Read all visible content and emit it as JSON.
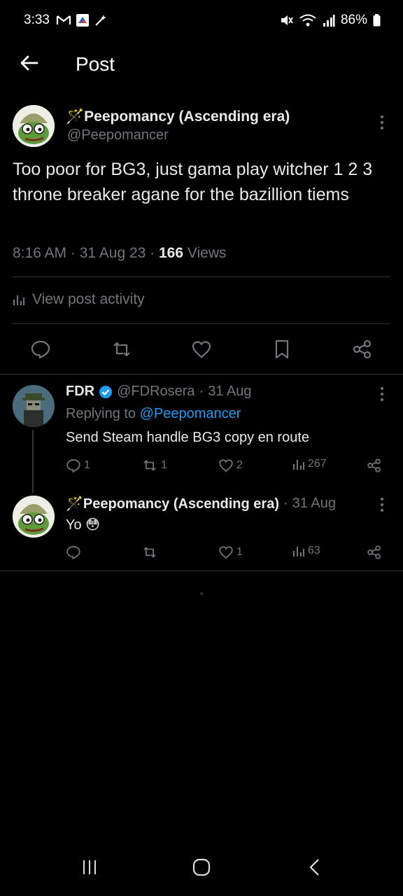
{
  "status_bar": {
    "time": "3:33",
    "battery": "86%"
  },
  "header": {
    "title": "Post"
  },
  "post": {
    "author_name": "🪄Peepomancy (Ascending era)",
    "author_handle": "@Peepomancer",
    "text": "Too poor for BG3, just gama play witcher 1 2 3 throne breaker agane for the bazillion tiems",
    "time": "8:16 AM",
    "date": "31 Aug 23",
    "views_count": "166",
    "views_label": "Views",
    "activity_label": "View post activity"
  },
  "replies": [
    {
      "name": "FDR",
      "handle": "@FDRosera",
      "date": "31 Aug",
      "replying_label": "Replying to",
      "replying_to": "@Peepomancer",
      "text": "Send Steam handle BG3 copy en route",
      "replies": "1",
      "reposts": "1",
      "likes": "2",
      "views": "267",
      "verified": true
    },
    {
      "name": "🪄Peepomancy (Ascending era)",
      "date": "31 Aug",
      "text": "Yo 😳",
      "replies": "",
      "reposts": "",
      "likes": "1",
      "views": "63"
    }
  ],
  "colors": {
    "background": "#000000",
    "text": "#e7e9ea",
    "muted": "#71767b",
    "link": "#1d9bf0",
    "divider": "#2f3336"
  }
}
